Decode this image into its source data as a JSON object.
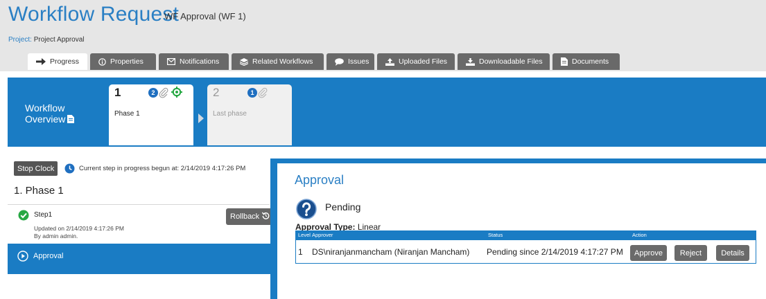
{
  "header": {
    "title": "Workflow Request",
    "subtitle": "WF Approval (WF 1)",
    "project_label": "Project:",
    "project_value": "Project Approval"
  },
  "tabs": [
    {
      "label": "Progress",
      "icon": "arrow-right-icon",
      "active": true
    },
    {
      "label": "Properties",
      "icon": "info-icon",
      "active": false
    },
    {
      "label": "Notifications",
      "icon": "envelope-icon",
      "active": false
    },
    {
      "label": "Related Workflows",
      "icon": "layers-icon",
      "active": false
    },
    {
      "label": "Issues",
      "icon": "speech-bubble-icon",
      "active": false
    },
    {
      "label": "Uploaded Files",
      "icon": "upload-icon",
      "active": false
    },
    {
      "label": "Downloadable Files",
      "icon": "download-icon",
      "active": false
    },
    {
      "label": "Documents",
      "icon": "document-icon",
      "active": false
    }
  ],
  "overview": {
    "label_line1": "Workflow",
    "label_line2": "Overview",
    "phases": [
      {
        "number": "1",
        "name": "Phase 1",
        "badge": "2"
      },
      {
        "number": "2",
        "name": "Last phase",
        "badge": "1"
      }
    ]
  },
  "left": {
    "stop_clock_label": "Stop Clock",
    "current_step_text": "Current step in progress begun at: 2/14/2019 4:17:26 PM",
    "phase_title": "1. Phase 1",
    "step_name": "Step1",
    "step_updated": "Updated on 2/14/2019 4:17:26 PM",
    "step_by": "By admin admin.",
    "rollback_label": "Rollback",
    "approval_label": "Approval"
  },
  "approval_panel": {
    "title": "Approval",
    "status": "Pending",
    "type_label": "Approval Type:",
    "type_value": "Linear",
    "columns": {
      "level": "Level",
      "approver": "Approver",
      "status": "Status",
      "action": "Action"
    },
    "row": {
      "level": "1",
      "approver": "DS\\niranjanmancham (Niranjan Mancham)",
      "status": "Pending since 2/14/2019 4:17:27 PM"
    },
    "actions": {
      "approve": "Approve",
      "reject": "Reject",
      "details": "Details"
    }
  },
  "colors": {
    "accent_blue": "#1a7cc4",
    "title_blue": "#2a7fc4",
    "tab_gray": "#696969",
    "success_green": "#27a844"
  }
}
